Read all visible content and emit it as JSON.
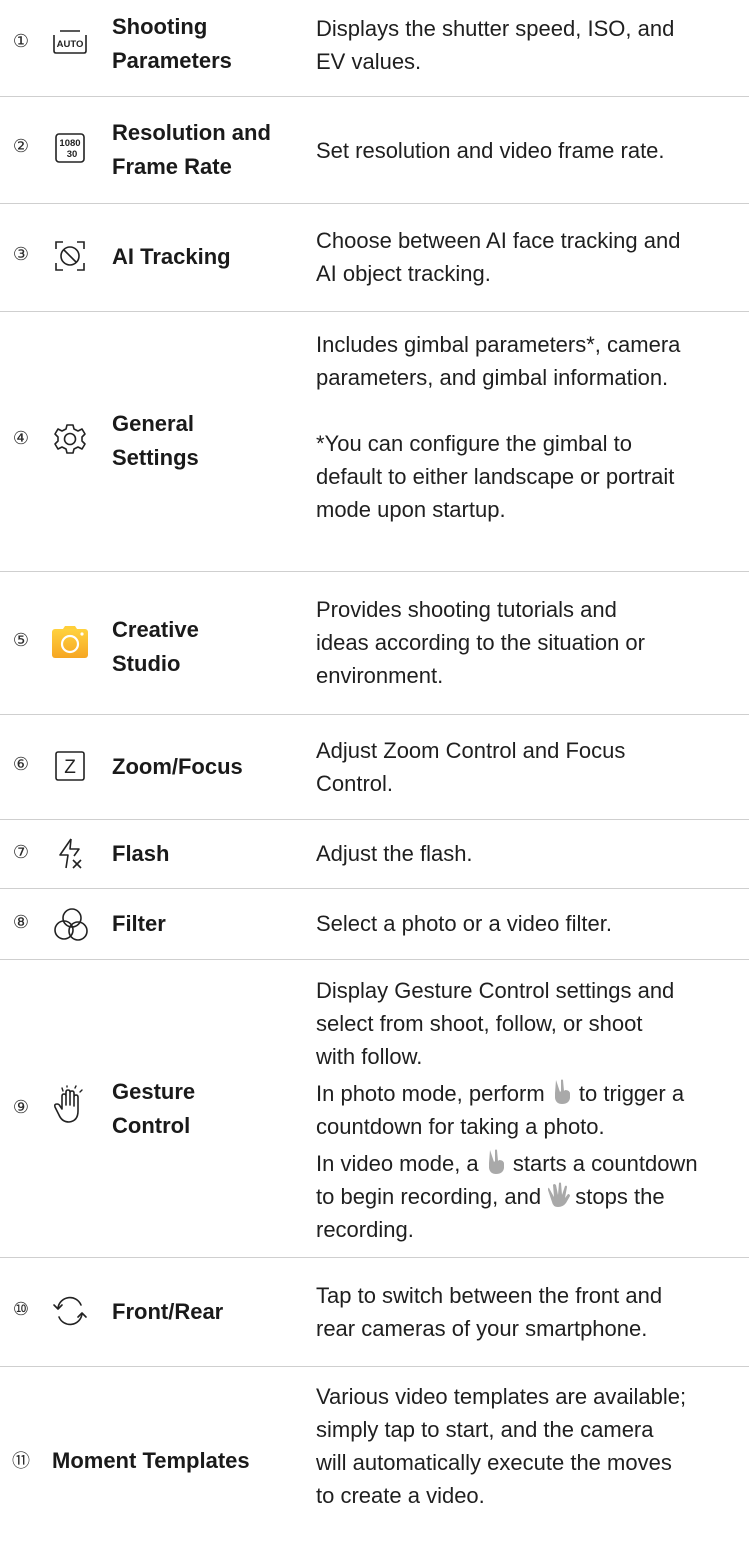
{
  "rows": [
    {
      "num": "①",
      "icon": "auto-icon",
      "name_lines": [
        "Shooting",
        "Parameters"
      ],
      "desc_lines": [
        "Displays the shutter speed, ISO, and",
        "EV values."
      ]
    },
    {
      "num": "②",
      "icon": "resolution-1080-30-icon",
      "icon_text": [
        "1080",
        "30"
      ],
      "name_lines": [
        "Resolution and",
        "Frame Rate"
      ],
      "desc_lines": [
        "Set resolution and video frame rate."
      ]
    },
    {
      "num": "③",
      "icon": "ai-tracking-icon",
      "name_lines": [
        "AI Tracking"
      ],
      "desc_lines": [
        "Choose between AI face tracking and",
        "AI object tracking."
      ]
    },
    {
      "num": "④",
      "icon": "gear-icon",
      "name_lines": [
        "General",
        "Settings"
      ],
      "desc_lines": [
        "Includes gimbal parameters*, camera",
        "parameters, and gimbal information."
      ],
      "desc_lines_2": [
        "*You can configure the gimbal to",
        "default to either landscape or portrait",
        "mode upon startup."
      ]
    },
    {
      "num": "⑤",
      "icon": "creative-studio-app-icon",
      "name_lines": [
        "Creative",
        "Studio"
      ],
      "desc_lines": [
        "Provides shooting tutorials and",
        "ideas according to the situation or",
        "environment."
      ]
    },
    {
      "num": "⑥",
      "icon": "zoom-focus-icon",
      "icon_text": [
        "Z"
      ],
      "name_lines": [
        "Zoom/Focus"
      ],
      "desc_lines": [
        "Adjust Zoom Control and Focus",
        "Control."
      ]
    },
    {
      "num": "⑦",
      "icon": "flash-off-icon",
      "name_lines": [
        "Flash"
      ],
      "desc_lines": [
        "Adjust the flash."
      ]
    },
    {
      "num": "⑧",
      "icon": "filter-icon",
      "name_lines": [
        "Filter"
      ],
      "desc_lines": [
        "Select a photo or a video filter."
      ]
    },
    {
      "num": "⑨",
      "icon": "gesture-hand-icon",
      "name_lines": [
        "Gesture",
        "Control"
      ],
      "desc_lines": [
        "Display Gesture Control settings and",
        "select from shoot, follow, or shoot",
        "with follow."
      ],
      "p2": {
        "a": "In photo mode, perform ",
        "b": " to trigger a",
        "c": "countdown for taking a photo."
      },
      "p3": {
        "a": "In video mode, a ",
        "b": " starts a countdown",
        "c": "to begin recording, and ",
        "d": " stops the",
        "e": "recording."
      }
    },
    {
      "num": "⑩",
      "icon": "switch-camera-icon",
      "name_lines": [
        "Front/Rear"
      ],
      "desc_lines": [
        "Tap to switch between the front and",
        "rear cameras of your smartphone."
      ]
    },
    {
      "num": "⑪",
      "name_lines": [
        "Moment Templates"
      ],
      "desc_lines": [
        "Various video templates are available;",
        "simply tap to start, and the camera",
        "will automatically execute the moves",
        "to create a video."
      ]
    }
  ],
  "colors": {
    "divider": "#cfcfcf",
    "studio_orange": "#f6a623",
    "studio_yellow": "#ffd23f",
    "gesture_gray": "#a9a9a9"
  }
}
